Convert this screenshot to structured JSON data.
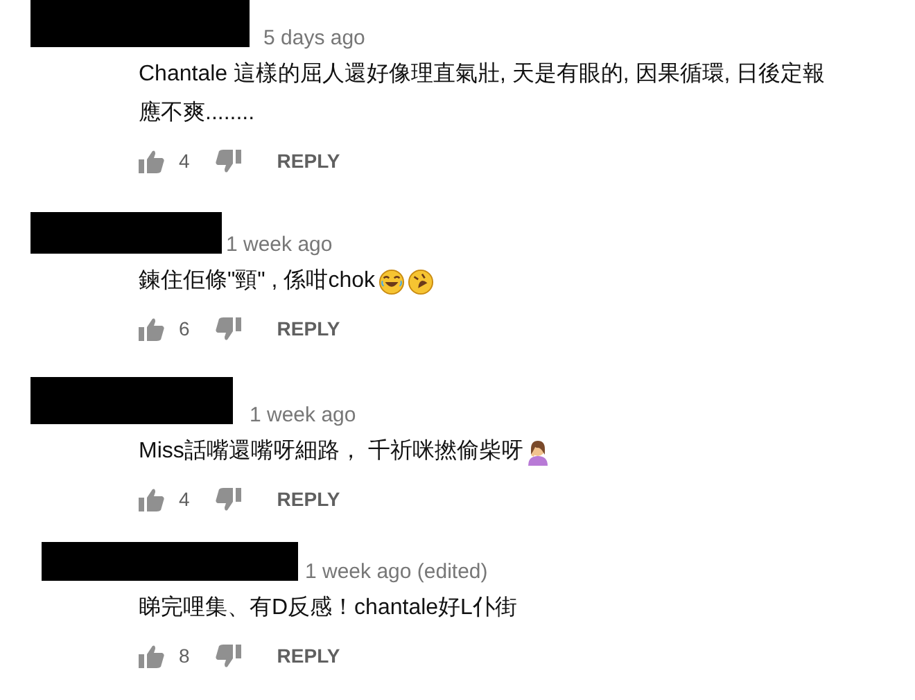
{
  "comments": [
    {
      "redacted": true,
      "time": "5 days ago",
      "text": "Chantale 這樣的屈人還好像理直氣壯, 天是有眼的, 因果循環, 日後定報應不爽........",
      "likes": "4",
      "reply": "REPLY"
    },
    {
      "redacted": true,
      "time": "1 week ago",
      "text": "鍊住佢條\"頸\" , 係咁chok",
      "likes": "6",
      "reply": "REPLY"
    },
    {
      "redacted": true,
      "time": "1 week ago",
      "text": "Miss話嘴還嘴呀細路， 千祈咪撚偷柴呀",
      "likes": "4",
      "reply": "REPLY"
    },
    {
      "redacted": true,
      "time": "1 week ago (edited)",
      "text": "睇完哩集、有D反感！chantale好L仆街",
      "likes": "8",
      "reply": "REPLY"
    }
  ]
}
